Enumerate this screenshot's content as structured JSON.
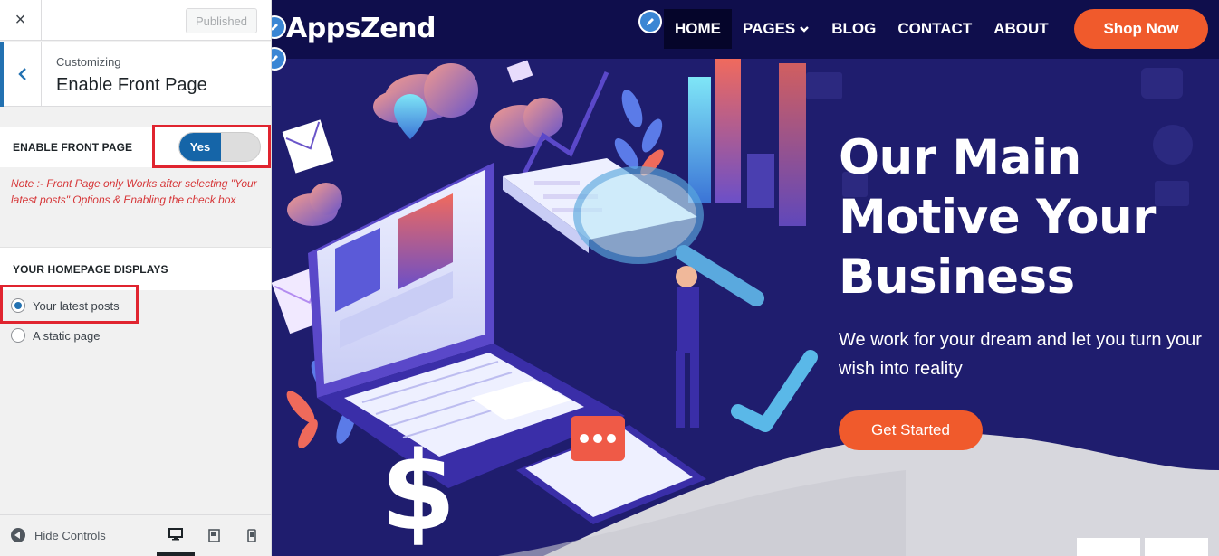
{
  "customizer": {
    "close_icon": "×",
    "publish_label": "Published",
    "breadcrumb": "Customizing",
    "section_title": "Enable Front Page",
    "enable_front_page_label": "ENABLE FRONT PAGE",
    "toggle_on_label": "Yes",
    "toggle_state": true,
    "note": "Note :- Front Page only Works after selecting \"Your latest posts\" Options & Enabling the check box",
    "homepage_displays_label": "YOUR HOMEPAGE DISPLAYS",
    "radio_options": [
      "Your latest posts",
      "A static page"
    ],
    "radio_selected": "Your latest posts",
    "hide_controls_label": "Hide Controls",
    "devices": [
      "desktop-icon",
      "tablet-icon",
      "mobile-icon"
    ],
    "accent_color": "#2271b1",
    "highlight_color": "#e0242f",
    "note_color": "#d63638"
  },
  "site": {
    "logo": "AppsZend",
    "nav": [
      "HOME",
      "PAGES",
      "BLOG",
      "CONTACT",
      "ABOUT"
    ],
    "nav_active": "HOME",
    "shop_button": "Shop Now",
    "hero_title": "Our Main Motive Your Business",
    "hero_subtitle": "We work for your dream and let you turn your wish into reality",
    "cta_button": "Get Started",
    "brand_color": "#f05a2c",
    "background_color": "#1f1d6e"
  }
}
